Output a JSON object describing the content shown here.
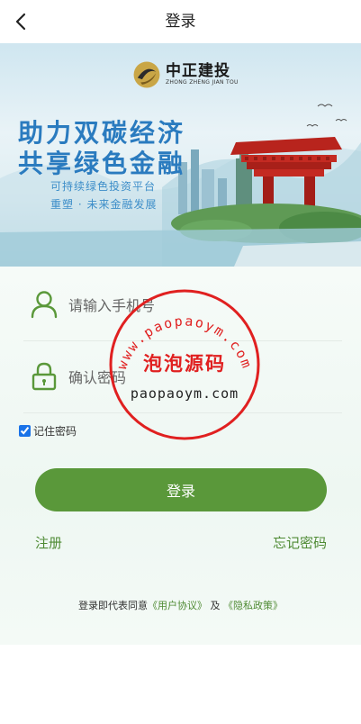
{
  "header": {
    "title": "登录",
    "back_icon": "chevron-left-icon"
  },
  "banner": {
    "brand_name": "中正建投",
    "brand_sub": "ZHONG ZHENG JIAN TOU",
    "headline_1": "助力双碳经济",
    "headline_2": "共享绿色金融",
    "tagline_1": "可持续绿色投资平台",
    "tagline_2": "重塑 · 未来金融发展"
  },
  "form": {
    "phone_placeholder": "请输入手机号",
    "password_placeholder": "确认密码",
    "remember_label": "记住密码",
    "remember_checked": true,
    "login_label": "登录",
    "register_label": "注册",
    "forgot_label": "忘记密码"
  },
  "agreement": {
    "prefix": "登录即代表同意",
    "user_agreement": "《用户协议》",
    "and": "及",
    "privacy": "《隐私政策》"
  },
  "watermark": {
    "arc_text": "www.paopaoym.com",
    "center_text": "泡泡源码",
    "bottom_text": "paopaoym.com"
  },
  "colors": {
    "accent": "#5a983a",
    "link": "#4e8a33",
    "headline": "#2a7bbf",
    "watermark": "#e02020"
  }
}
